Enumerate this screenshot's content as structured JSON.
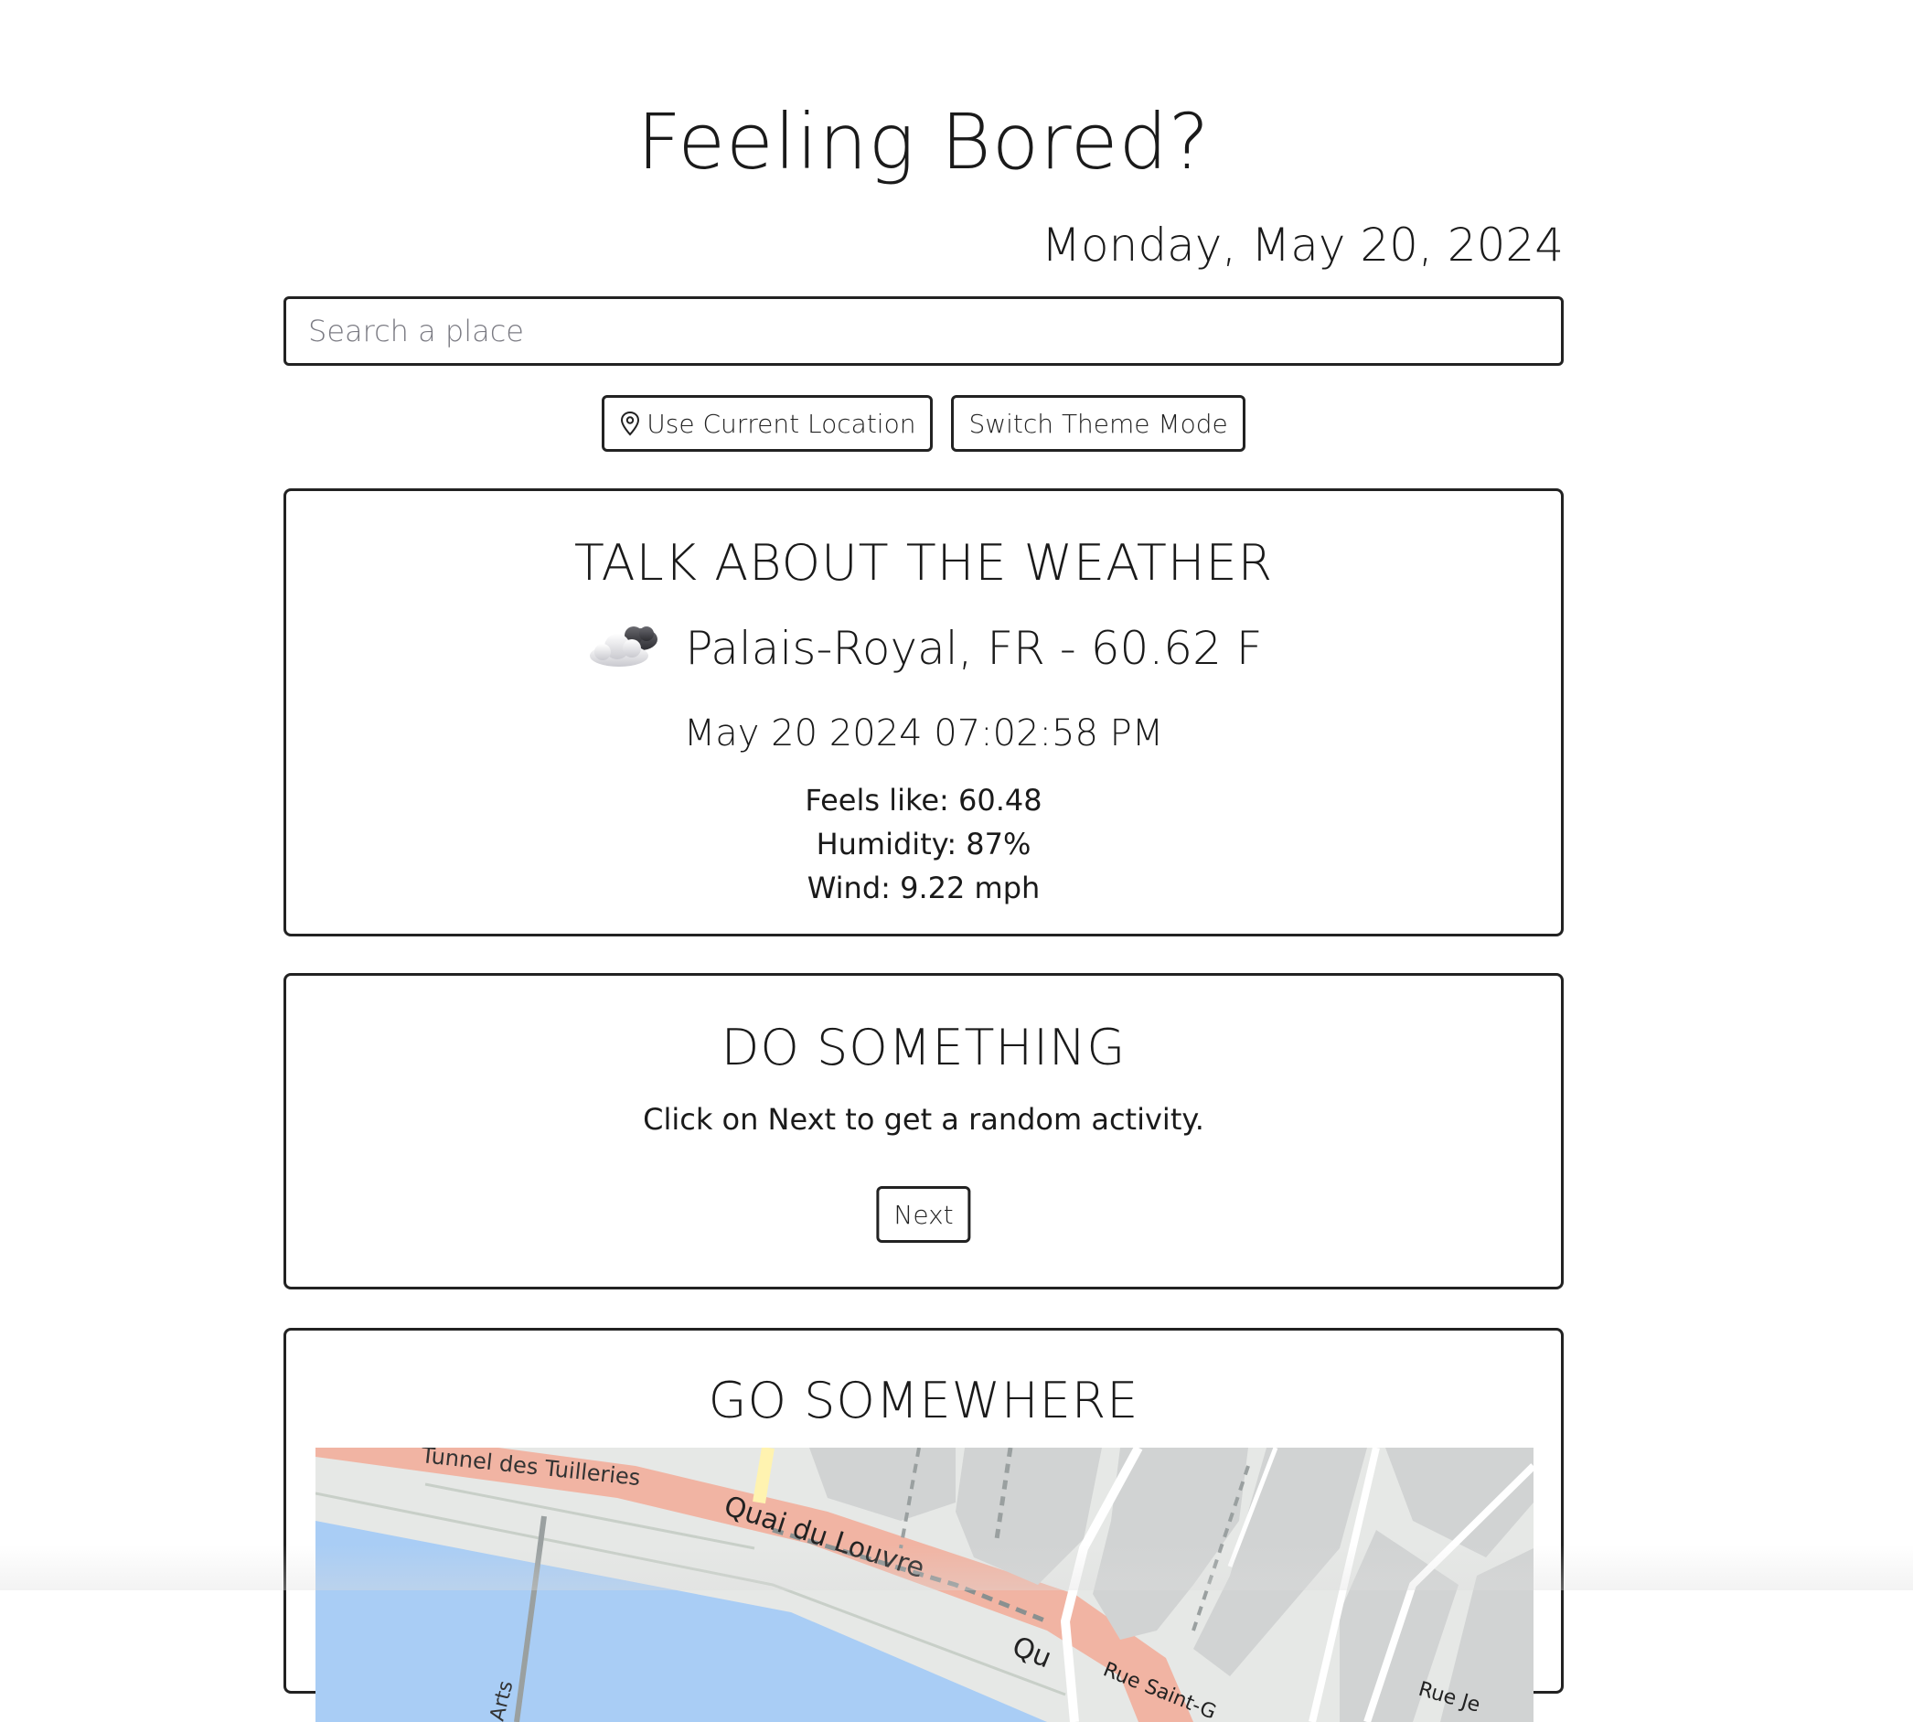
{
  "header": {
    "title": "Feeling Bored?",
    "date": "Monday, May 20, 2024"
  },
  "search": {
    "placeholder": "Search a place",
    "value": ""
  },
  "controls": {
    "location_label": "Use Current Location",
    "theme_label": "Switch Theme Mode"
  },
  "weather": {
    "title": "TALK ABOUT THE WEATHER",
    "icon": "partly-cloudy-icon",
    "location": "Palais-Royal, FR - 60.62 F",
    "datetime": "May 20 2024 07:02:58 PM",
    "feels_like": "Feels like: 60.48",
    "humidity": "Humidity: 87%",
    "wind": "Wind: 9.22 mph"
  },
  "activity": {
    "title": "DO SOMETHING",
    "text": "Click on Next to get a random activity.",
    "next_label": "Next"
  },
  "places": {
    "title": "GO SOMEWHERE",
    "map": {
      "labels": {
        "tunnel": "Tunnel des Tuilleries",
        "quai": "Quai du Louvre",
        "quai_partial": "Qu",
        "arts": "Arts",
        "rue_saint": "Rue Saint-G",
        "rue": "Rue Je"
      },
      "colors": {
        "river": "#a9cdf5",
        "road": "#f1b4a3",
        "buildings": "#d1d3d3",
        "ground": "#e6e8e6"
      }
    }
  }
}
